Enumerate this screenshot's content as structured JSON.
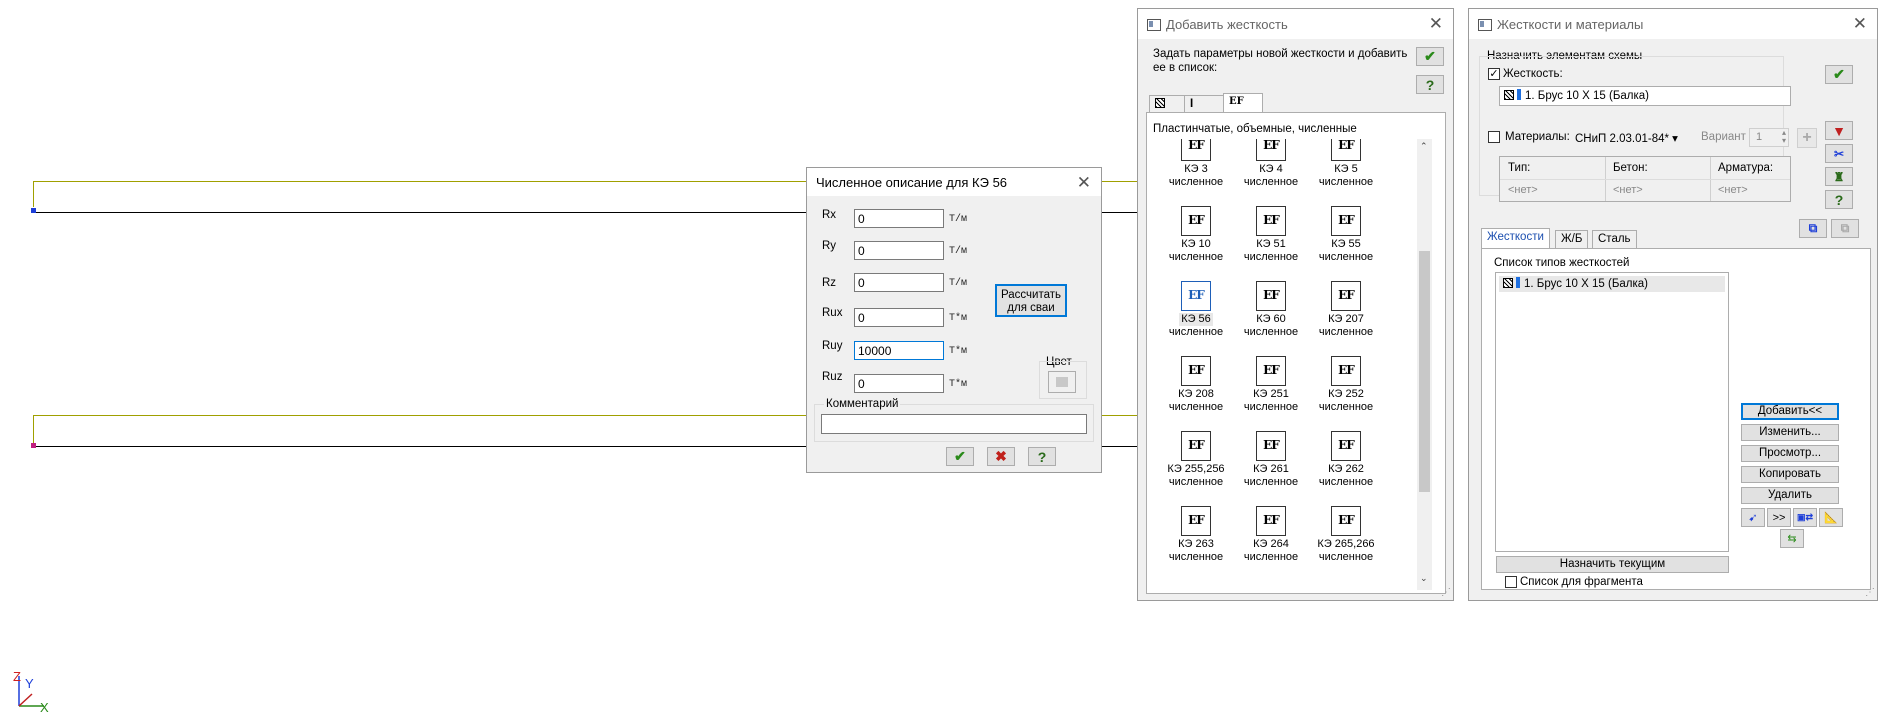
{
  "axis_labels": {
    "z": "Z",
    "y": "Y",
    "x": "X"
  },
  "colors": {
    "beam_upper": "#a0a000",
    "beam_lower": "#000000",
    "accent": "#0078d7"
  },
  "numeric_dialog": {
    "title": "Численное описание для КЭ 56",
    "rows": [
      {
        "label": "Rx",
        "value": "0",
        "unit": "Т/м"
      },
      {
        "label": "Ry",
        "value": "0",
        "unit": "Т/м"
      },
      {
        "label": "Rz",
        "value": "0",
        "unit": "Т/м"
      },
      {
        "label": "Rux",
        "value": "0",
        "unit": "Т*м"
      },
      {
        "label": "Ruy",
        "value": "10000",
        "unit": "Т*м"
      },
      {
        "label": "Ruz",
        "value": "0",
        "unit": "Т*м"
      }
    ],
    "calc_button": "Рассчитать для сваи",
    "color_label": "Цвет",
    "comment_label": "Комментарий",
    "comment_value": "",
    "ok_icon": "check-icon",
    "cancel_icon": "cross-icon",
    "help_icon": "help-icon"
  },
  "add_stiffness": {
    "title": "Добавить жесткость",
    "description": "Задать параметры новой жесткости и добавить ее в список:",
    "tabs": [
      "hatch-icon",
      "ibeam-icon",
      "EF"
    ],
    "group_label": "Пластинчатые, объемные, численные",
    "tiles": [
      {
        "name": "КЭ 3",
        "sub": "численное"
      },
      {
        "name": "КЭ 4",
        "sub": "численное"
      },
      {
        "name": "КЭ 5",
        "sub": "численное"
      },
      {
        "name": "КЭ 10",
        "sub": "численное"
      },
      {
        "name": "КЭ 51",
        "sub": "численное"
      },
      {
        "name": "КЭ 55",
        "sub": "численное"
      },
      {
        "name": "КЭ 56",
        "sub": "численное",
        "selected": true
      },
      {
        "name": "КЭ 60",
        "sub": "численное"
      },
      {
        "name": "КЭ 207",
        "sub": "численное"
      },
      {
        "name": "КЭ 208",
        "sub": "численное"
      },
      {
        "name": "КЭ 251",
        "sub": "численное"
      },
      {
        "name": "КЭ 252",
        "sub": "численное"
      },
      {
        "name": "КЭ 255,256",
        "sub": "численное"
      },
      {
        "name": "КЭ 261",
        "sub": "численное"
      },
      {
        "name": "КЭ 262",
        "sub": "численное"
      },
      {
        "name": "КЭ 263",
        "sub": "численное"
      },
      {
        "name": "КЭ 264",
        "sub": "численное"
      },
      {
        "name": "КЭ 265,266",
        "sub": "численное"
      }
    ],
    "tile_icon_text": "EF"
  },
  "materials": {
    "title": "Жесткости и материалы",
    "assign_group": "Назначить элементам схемы",
    "stiffness_label": "Жесткость:",
    "stiffness_value": "1. Брус 10 X 15 (Балка)",
    "materials_label": "Материалы:",
    "norm_value": "СНиП 2.03.01-84*",
    "variant_label": "Вариант",
    "variant_value": "1",
    "grid_headers": [
      "Тип:",
      "Бетон:",
      "Арматура:"
    ],
    "grid_values": [
      "<нет>",
      "<нет>",
      "<нет>"
    ],
    "tabs": [
      "Жесткости",
      "Ж/Б",
      "Сталь"
    ],
    "list_label": "Список типов жесткостей",
    "list_items": [
      "1. Брус 10 X 15 (Балка)"
    ],
    "buttons": [
      "Добавить<<",
      "Изменить...",
      "Просмотр...",
      "Копировать",
      "Удалить"
    ],
    "tool_icons": [
      "pointer-icon",
      ">>",
      "compare-icon",
      "measure-icon"
    ],
    "assign_current": "Назначить текущим",
    "fragment_label": "Список для фрагмента"
  }
}
